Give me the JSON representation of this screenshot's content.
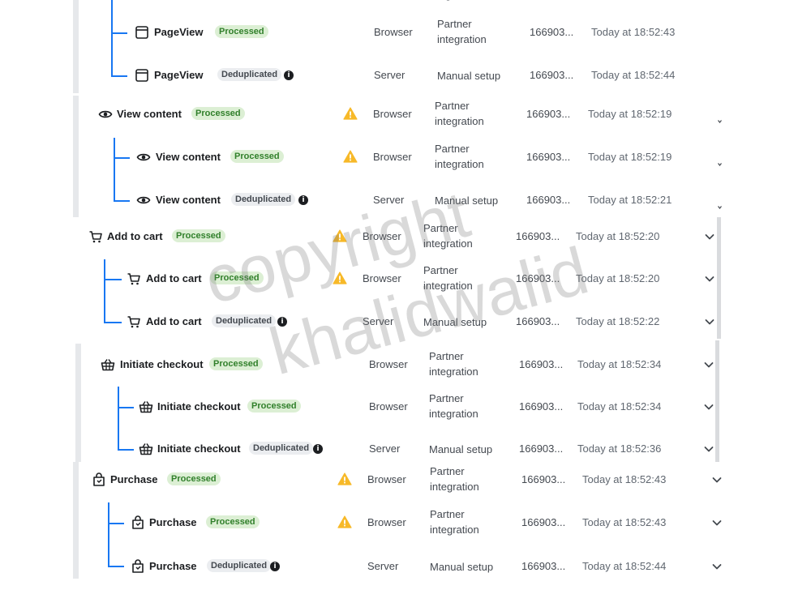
{
  "rows": [
    {
      "name": "PageView",
      "icon": "window-icon",
      "status": "Processed",
      "info": false,
      "warning": false,
      "source": "Browser",
      "method": "Partner integration",
      "event_id": "166903...",
      "time": "Today at 18:52:43",
      "chevron": false
    },
    {
      "name": "PageView",
      "icon": "window-icon",
      "status": "Deduplicated",
      "info": true,
      "warning": false,
      "source": "Server",
      "method": "Manual setup",
      "event_id": "166903...",
      "time": "Today at 18:52:44",
      "chevron": false
    },
    {
      "name": "View content",
      "icon": "eye-icon",
      "status": "Processed",
      "info": false,
      "warning": true,
      "source": "Browser",
      "method": "Partner integration",
      "event_id": "166903...",
      "time": "Today at 18:52:19",
      "chevron": "tick"
    },
    {
      "name": "View content",
      "icon": "eye-icon",
      "status": "Processed",
      "info": false,
      "warning": true,
      "source": "Browser",
      "method": "Partner integration",
      "event_id": "166903...",
      "time": "Today at 18:52:19",
      "chevron": "tick"
    },
    {
      "name": "View content",
      "icon": "eye-icon",
      "status": "Deduplicated",
      "info": true,
      "warning": false,
      "source": "Server",
      "method": "Manual setup",
      "event_id": "166903...",
      "time": "Today at 18:52:21",
      "chevron": "tick"
    },
    {
      "name": "Add to cart",
      "icon": "cart-icon",
      "status": "Processed",
      "info": false,
      "warning": true,
      "source": "Browser",
      "method": "Partner integration",
      "event_id": "166903...",
      "time": "Today at 18:52:20",
      "chevron": true
    },
    {
      "name": "Add to cart",
      "icon": "cart-icon",
      "status": "Processed",
      "info": false,
      "warning": true,
      "source": "Browser",
      "method": "Partner integration",
      "event_id": "166903...",
      "time": "Today at 18:52:20",
      "chevron": true
    },
    {
      "name": "Add to cart",
      "icon": "cart-icon",
      "status": "Deduplicated",
      "info": true,
      "warning": false,
      "source": "Server",
      "method": "Manual setup",
      "event_id": "166903...",
      "time": "Today at 18:52:22",
      "chevron": true
    },
    {
      "name": "Initiate checkout",
      "icon": "basket-icon",
      "status": "Processed",
      "info": false,
      "warning": false,
      "source": "Browser",
      "method": "Partner integration",
      "event_id": "166903...",
      "time": "Today at 18:52:34",
      "chevron": true
    },
    {
      "name": "Initiate checkout",
      "icon": "basket-icon",
      "status": "Processed",
      "info": false,
      "warning": false,
      "source": "Browser",
      "method": "Partner integration",
      "event_id": "166903...",
      "time": "Today at 18:52:34",
      "chevron": true
    },
    {
      "name": "Initiate checkout",
      "icon": "basket-icon",
      "status": "Deduplicated",
      "info": true,
      "warning": false,
      "source": "Server",
      "method": "Manual setup",
      "event_id": "166903...",
      "time": "Today at 18:52:36",
      "chevron": true
    },
    {
      "name": "Purchase",
      "icon": "shopping-bag-icon",
      "status": "Processed",
      "info": false,
      "warning": true,
      "source": "Browser",
      "method": "Partner integration",
      "event_id": "166903...",
      "time": "Today at 18:52:43",
      "chevron": true
    },
    {
      "name": "Purchase",
      "icon": "shopping-bag-icon",
      "status": "Processed",
      "info": false,
      "warning": true,
      "source": "Browser",
      "method": "Partner integration",
      "event_id": "166903...",
      "time": "Today at 18:52:43",
      "chevron": true
    },
    {
      "name": "Purchase",
      "icon": "shopping-bag-icon",
      "status": "Deduplicated",
      "info": true,
      "warning": false,
      "source": "Server",
      "method": "Manual setup",
      "event_id": "166903...",
      "time": "Today at 18:52:44",
      "chevron": true
    }
  ],
  "watermark": {
    "line1": "copyright",
    "line2": "khalidwalid"
  },
  "colors": {
    "tree_line": "#1877f2",
    "processed_bg": "#dcefd4",
    "processed_fg": "#31802b",
    "warning": "#f7b928"
  }
}
